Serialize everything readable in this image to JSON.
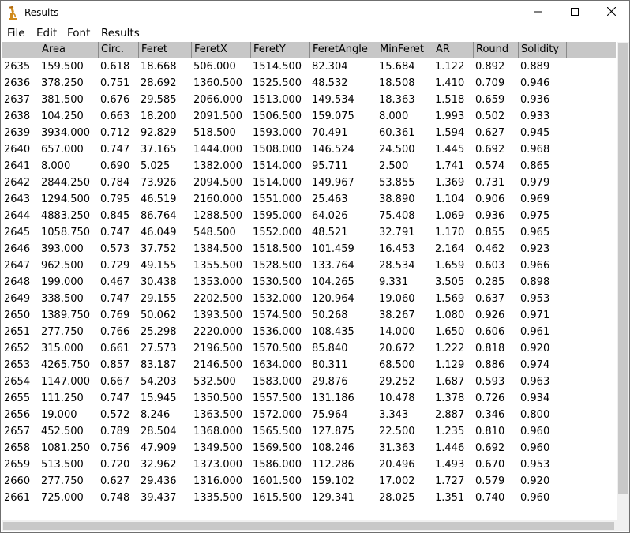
{
  "window": {
    "title": "Results"
  },
  "controls": {
    "minimize": "—",
    "maximize": "☐",
    "close": "✕"
  },
  "menu": [
    "File",
    "Edit",
    "Font",
    "Results"
  ],
  "columns": [
    "",
    "Area",
    "Circ.",
    "Feret",
    "FeretX",
    "FeretY",
    "FeretAngle",
    "MinFeret",
    "AR",
    "Round",
    "Solidity"
  ],
  "rows": [
    [
      "2635",
      "159.500",
      "0.618",
      "18.668",
      "506.000",
      "1514.500",
      "82.304",
      "15.684",
      "1.122",
      "0.892",
      "0.889"
    ],
    [
      "2636",
      "378.250",
      "0.751",
      "28.692",
      "1360.500",
      "1525.500",
      "48.532",
      "18.508",
      "1.410",
      "0.709",
      "0.946"
    ],
    [
      "2637",
      "381.500",
      "0.676",
      "29.585",
      "2066.000",
      "1513.000",
      "149.534",
      "18.363",
      "1.518",
      "0.659",
      "0.936"
    ],
    [
      "2638",
      "104.250",
      "0.663",
      "18.200",
      "2091.500",
      "1506.500",
      "159.075",
      "8.000",
      "1.993",
      "0.502",
      "0.933"
    ],
    [
      "2639",
      "3934.000",
      "0.712",
      "92.829",
      "518.500",
      "1593.000",
      "70.491",
      "60.361",
      "1.594",
      "0.627",
      "0.945"
    ],
    [
      "2640",
      "657.000",
      "0.747",
      "37.165",
      "1444.000",
      "1508.000",
      "146.524",
      "24.500",
      "1.445",
      "0.692",
      "0.968"
    ],
    [
      "2641",
      "8.000",
      "0.690",
      "5.025",
      "1382.000",
      "1514.000",
      "95.711",
      "2.500",
      "1.741",
      "0.574",
      "0.865"
    ],
    [
      "2642",
      "2844.250",
      "0.784",
      "73.926",
      "2094.500",
      "1514.000",
      "149.967",
      "53.855",
      "1.369",
      "0.731",
      "0.979"
    ],
    [
      "2643",
      "1294.500",
      "0.795",
      "46.519",
      "2160.000",
      "1551.000",
      "25.463",
      "38.890",
      "1.104",
      "0.906",
      "0.969"
    ],
    [
      "2644",
      "4883.250",
      "0.845",
      "86.764",
      "1288.500",
      "1595.000",
      "64.026",
      "75.408",
      "1.069",
      "0.936",
      "0.975"
    ],
    [
      "2645",
      "1058.750",
      "0.747",
      "46.049",
      "548.500",
      "1552.000",
      "48.521",
      "32.791",
      "1.170",
      "0.855",
      "0.965"
    ],
    [
      "2646",
      "393.000",
      "0.573",
      "37.752",
      "1384.500",
      "1518.500",
      "101.459",
      "16.453",
      "2.164",
      "0.462",
      "0.923"
    ],
    [
      "2647",
      "962.500",
      "0.729",
      "49.155",
      "1355.500",
      "1528.500",
      "133.764",
      "28.534",
      "1.659",
      "0.603",
      "0.966"
    ],
    [
      "2648",
      "199.000",
      "0.467",
      "30.438",
      "1353.000",
      "1530.500",
      "104.265",
      "9.331",
      "3.505",
      "0.285",
      "0.898"
    ],
    [
      "2649",
      "338.500",
      "0.747",
      "29.155",
      "2202.500",
      "1532.000",
      "120.964",
      "19.060",
      "1.569",
      "0.637",
      "0.953"
    ],
    [
      "2650",
      "1389.750",
      "0.769",
      "50.062",
      "1393.500",
      "1574.500",
      "50.268",
      "38.267",
      "1.080",
      "0.926",
      "0.971"
    ],
    [
      "2651",
      "277.750",
      "0.766",
      "25.298",
      "2220.000",
      "1536.000",
      "108.435",
      "14.000",
      "1.650",
      "0.606",
      "0.961"
    ],
    [
      "2652",
      "315.000",
      "0.661",
      "27.573",
      "2196.500",
      "1570.500",
      "85.840",
      "20.672",
      "1.222",
      "0.818",
      "0.920"
    ],
    [
      "2653",
      "4265.750",
      "0.857",
      "83.187",
      "2146.500",
      "1634.000",
      "80.311",
      "68.500",
      "1.129",
      "0.886",
      "0.974"
    ],
    [
      "2654",
      "1147.000",
      "0.667",
      "54.203",
      "532.500",
      "1583.000",
      "29.876",
      "29.252",
      "1.687",
      "0.593",
      "0.963"
    ],
    [
      "2655",
      "111.250",
      "0.747",
      "15.945",
      "1350.500",
      "1557.500",
      "131.186",
      "10.478",
      "1.378",
      "0.726",
      "0.934"
    ],
    [
      "2656",
      "19.000",
      "0.572",
      "8.246",
      "1363.500",
      "1572.000",
      "75.964",
      "3.343",
      "2.887",
      "0.346",
      "0.800"
    ],
    [
      "2657",
      "452.500",
      "0.789",
      "28.504",
      "1368.000",
      "1565.500",
      "127.875",
      "22.500",
      "1.235",
      "0.810",
      "0.960"
    ],
    [
      "2658",
      "1081.250",
      "0.756",
      "47.909",
      "1349.500",
      "1569.500",
      "108.246",
      "31.363",
      "1.446",
      "0.692",
      "0.960"
    ],
    [
      "2659",
      "513.500",
      "0.720",
      "32.962",
      "1373.000",
      "1586.000",
      "112.286",
      "20.496",
      "1.493",
      "0.670",
      "0.953"
    ],
    [
      "2660",
      "277.750",
      "0.627",
      "29.436",
      "1316.000",
      "1601.500",
      "159.102",
      "17.002",
      "1.727",
      "0.579",
      "0.920"
    ],
    [
      "2661",
      "725.000",
      "0.748",
      "39.437",
      "1335.500",
      "1615.500",
      "129.341",
      "28.025",
      "1.351",
      "0.740",
      "0.960"
    ]
  ]
}
